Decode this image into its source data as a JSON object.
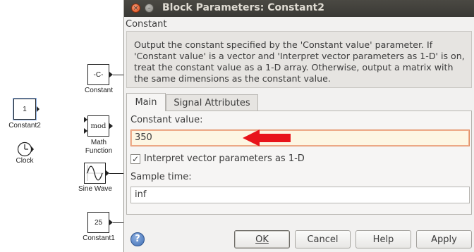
{
  "canvas": {
    "blocks": {
      "constant": {
        "value": "-C-",
        "label": "Constant"
      },
      "constant2": {
        "value": "1",
        "label": "Constant2"
      },
      "math_function": {
        "value": "mod",
        "label_line1": "Math",
        "label_line2": "Function"
      },
      "clock": {
        "label": "Clock"
      },
      "sine_wave": {
        "label": "Sine Wave"
      },
      "constant1": {
        "value": "25",
        "label": "Constant1"
      }
    }
  },
  "dialog": {
    "title": "Block Parameters: Constant2",
    "block_type": "Constant",
    "description": "Output the constant specified by the 'Constant value' parameter. If 'Constant value' is a vector and 'Interpret vector parameters as 1-D' is on, treat the constant value as a 1-D array. Otherwise, output a matrix with the same dimensions as the constant value.",
    "tabs": [
      {
        "label": "Main",
        "active": true
      },
      {
        "label": "Signal Attributes",
        "active": false
      }
    ],
    "main": {
      "constant_value_label": "Constant value:",
      "constant_value": "350",
      "interpret_vector_label": "Interpret vector parameters as 1-D",
      "interpret_vector_checked": true,
      "sample_time_label": "Sample time:",
      "sample_time": "inf"
    },
    "buttons": {
      "help_icon": "?",
      "ok": "OK",
      "cancel": "Cancel",
      "help": "Help",
      "apply": "Apply"
    },
    "annotation_arrow_color": "#e8141b"
  }
}
